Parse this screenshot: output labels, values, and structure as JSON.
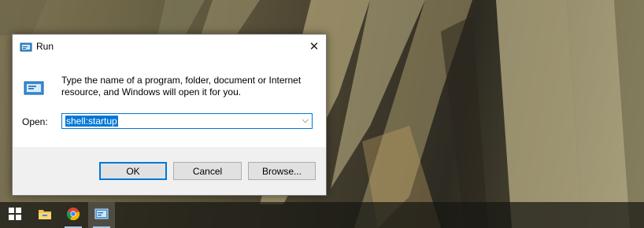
{
  "window": {
    "title": "Run",
    "close_glyph": "✕",
    "description": "Type the name of a program, folder, document or Internet resource, and Windows will open it for you.",
    "open_label": "Open:",
    "open_value": "shell:startup",
    "dropdown_glyph": "⌵",
    "buttons": {
      "ok": "OK",
      "cancel": "Cancel",
      "browse": "Browse..."
    }
  },
  "taskbar": {
    "items": [
      {
        "icon": "windows-start-icon"
      },
      {
        "icon": "file-explorer-icon"
      },
      {
        "icon": "chrome-icon"
      },
      {
        "icon": "run-app-icon",
        "active": true
      }
    ]
  },
  "colors": {
    "accent": "#0078d7",
    "dialog_bg": "#f0f0f0",
    "button_bg": "#e1e1e1"
  }
}
